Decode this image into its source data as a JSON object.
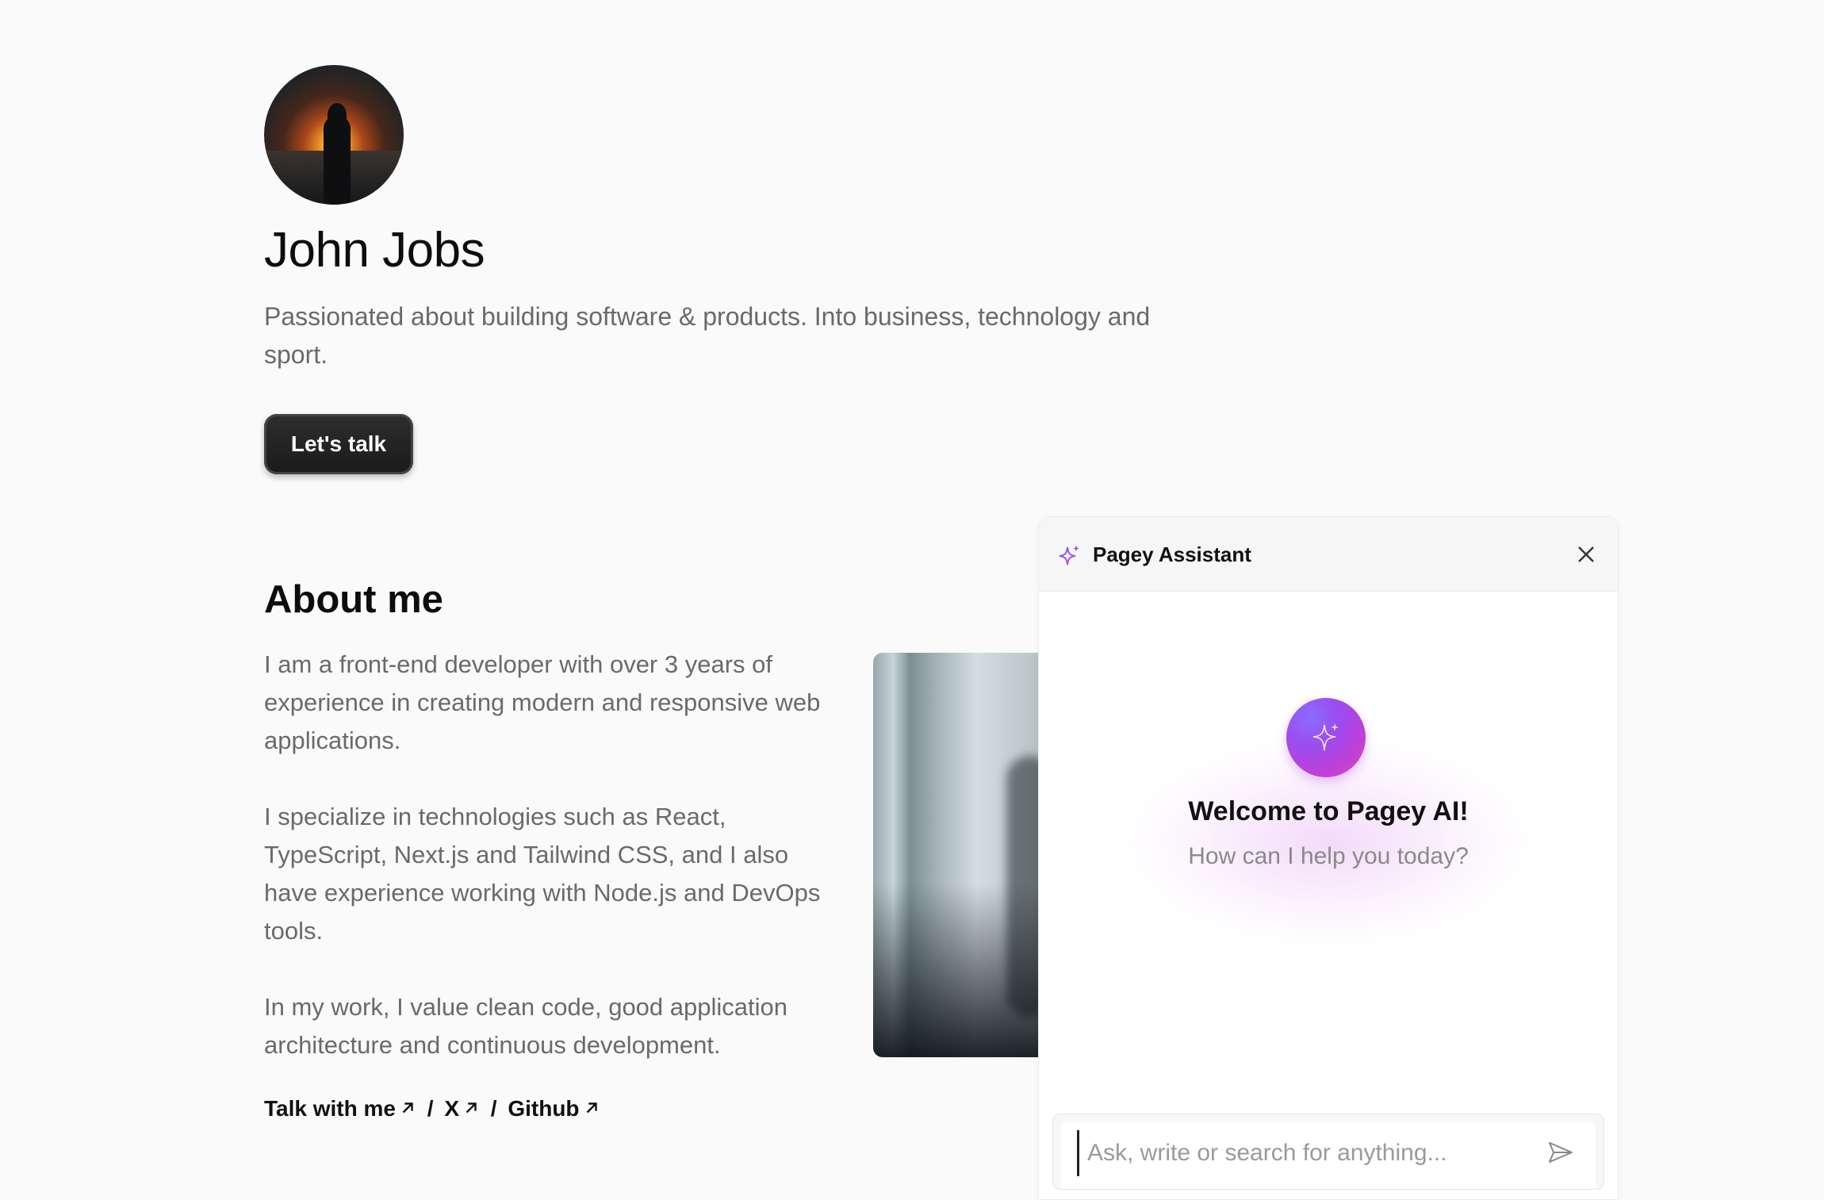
{
  "profile": {
    "name": "John Jobs",
    "tagline": "Passionated about building software & products. Into business, technology and sport.",
    "cta_label": "Let's talk"
  },
  "about": {
    "title": "About me",
    "paragraphs": [
      "I am a front-end developer with over 3 years of experience in creating modern and responsive web applications.",
      "I specialize in technologies such as React, TypeScript, Next.js and Tailwind CSS, and I also have experience working with Node.js and DevOps tools.",
      "In my work, I value clean code, good application architecture and continuous development."
    ],
    "links": [
      {
        "label": "Talk with me",
        "icon": "arrow-up-right-icon"
      },
      {
        "label": "X",
        "icon": "arrow-up-right-icon"
      },
      {
        "label": "Github",
        "icon": "arrow-up-right-icon"
      }
    ],
    "link_separator": "/"
  },
  "assistant": {
    "title": "Pagey Assistant",
    "welcome": "Welcome to Pagey AI!",
    "subtitle": "How can I help you today?",
    "input_placeholder": "Ask, write or search for anything...",
    "accent_color": "#a64ee6",
    "icons": [
      "sparkle-icon",
      "close-icon",
      "send-icon"
    ]
  }
}
